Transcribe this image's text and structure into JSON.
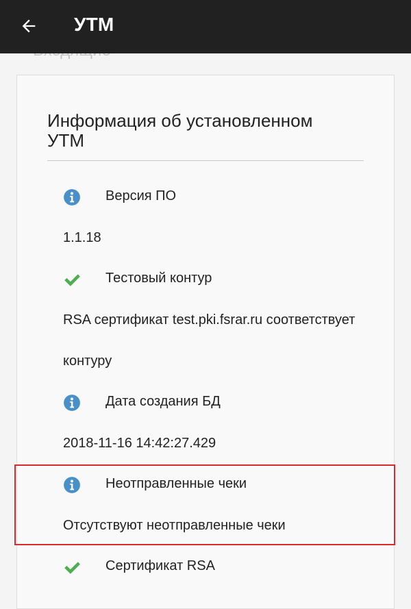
{
  "appbar": {
    "title": "УТМ",
    "back_icon": "arrow-left-icon"
  },
  "behind_tab": {
    "label": "Входящие"
  },
  "card": {
    "title": "Информация об установленном УТМ",
    "items": [
      {
        "icon": "info-icon",
        "label": "Версия ПО",
        "value_lines": [
          "1.1.18"
        ]
      },
      {
        "icon": "checkmark-icon",
        "label": "Тестовый контур",
        "value_lines": [
          "RSA сертификат test.pki.fsrar.ru соответствует",
          "контуру"
        ]
      },
      {
        "icon": "info-icon",
        "label": "Дата создания БД",
        "value_lines": [
          "2018-11-16 14:42:27.429"
        ]
      },
      {
        "icon": "info-icon",
        "label": "Неотправленные чеки",
        "value_lines": [
          "Отсутствуют неотправленные чеки"
        ]
      },
      {
        "icon": "checkmark-icon",
        "label": "Сертификат RSA",
        "value_lines": []
      }
    ]
  },
  "colors": {
    "appbar_bg": "#212121",
    "info_icon": "#4a90c8",
    "check_icon": "#4caf50",
    "highlight_border": "#d62b2b"
  }
}
